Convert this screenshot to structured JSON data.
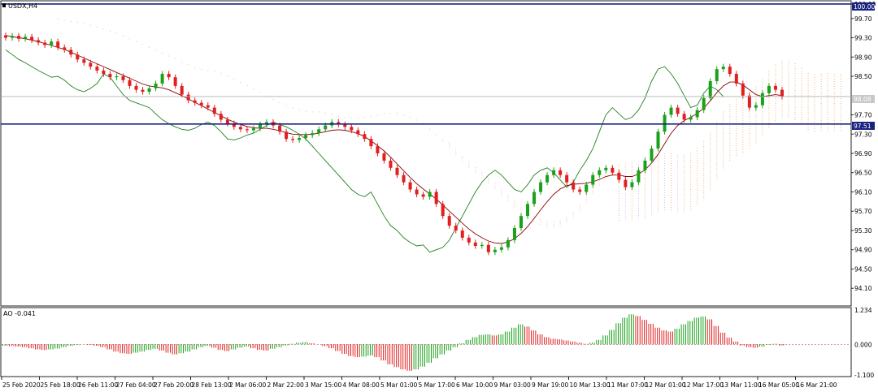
{
  "window": {
    "symbol_label": "USDX,H4"
  },
  "price_levels": {
    "top": "100.00",
    "mid": "98.08",
    "low": "97.51"
  },
  "ao_panel": {
    "label": "AO -0.041"
  },
  "colors": {
    "bull": "#1aa11a",
    "bear": "#e01f1f",
    "ma": "#8b0000",
    "osc": "#208020",
    "cloud_a": "#d8a8d8",
    "cloud_b": "#f0a060",
    "level_line": "#1a237e"
  },
  "chart_data": [
    {
      "type": "candlestick",
      "series": [
        {
          "name": "USDX,H4",
          "closes": [
            99.3,
            99.34,
            99.28,
            99.32,
            99.25,
            99.2,
            99.15,
            99.22,
            99.1,
            99.05,
            98.95,
            98.85,
            98.78,
            98.7,
            98.62,
            98.55,
            98.48,
            98.5,
            98.42,
            98.3,
            98.22,
            98.18,
            98.25,
            98.35,
            98.55,
            98.48,
            98.3,
            98.12,
            98.0,
            97.95,
            97.9,
            97.85,
            97.72,
            97.6,
            97.52,
            97.45,
            97.4,
            97.38,
            97.42,
            97.5,
            97.55,
            97.48,
            97.35,
            97.2,
            97.18,
            97.22,
            97.28,
            97.32,
            97.4,
            97.48,
            97.55,
            97.5,
            97.45,
            97.38,
            97.3,
            97.2,
            97.05,
            96.9,
            96.75,
            96.6,
            96.45,
            96.3,
            96.15,
            96.05,
            96.0,
            96.1,
            95.85,
            95.6,
            95.4,
            95.3,
            95.15,
            95.05,
            94.98,
            95.0,
            94.85,
            94.9,
            94.95,
            95.1,
            95.35,
            95.6,
            95.85,
            96.1,
            96.3,
            96.45,
            96.55,
            96.45,
            96.3,
            96.15,
            96.1,
            96.25,
            96.45,
            96.55,
            96.6,
            96.5,
            96.35,
            96.2,
            96.3,
            96.55,
            96.75,
            97.0,
            97.35,
            97.7,
            97.85,
            97.72,
            97.6,
            97.65,
            97.8,
            98.05,
            98.4,
            98.65,
            98.7,
            98.55,
            98.35,
            98.1,
            97.85,
            97.9,
            98.15,
            98.3,
            98.22,
            98.08
          ]
        },
        {
          "name": "MA",
          "values": [
            99.35,
            99.32,
            99.3,
            99.28,
            99.25,
            99.22,
            99.18,
            99.14,
            99.1,
            99.06,
            99.0,
            98.94,
            98.88,
            98.82,
            98.76,
            98.7,
            98.64,
            98.58,
            98.52,
            98.46,
            98.4,
            98.34,
            98.3,
            98.28,
            98.26,
            98.22,
            98.16,
            98.1,
            98.03,
            97.96,
            97.89,
            97.82,
            97.75,
            97.68,
            97.61,
            97.55,
            97.5,
            97.46,
            97.43,
            97.42,
            97.42,
            97.4,
            97.37,
            97.33,
            97.3,
            97.29,
            97.29,
            97.3,
            97.32,
            97.35,
            97.38,
            97.39,
            97.38,
            97.35,
            97.31,
            97.25,
            97.16,
            97.06,
            96.95,
            96.82,
            96.68,
            96.54,
            96.4,
            96.27,
            96.16,
            96.06,
            95.95,
            95.83,
            95.7,
            95.58,
            95.45,
            95.33,
            95.23,
            95.15,
            95.08,
            95.04,
            95.03,
            95.06,
            95.13,
            95.24,
            95.38,
            95.55,
            95.73,
            95.9,
            96.05,
            96.16,
            96.23,
            96.26,
            96.27,
            96.28,
            96.31,
            96.36,
            96.42,
            96.45,
            96.45,
            96.42,
            96.42,
            96.47,
            96.56,
            96.7,
            96.88,
            97.1,
            97.32,
            97.48,
            97.58,
            97.65,
            97.73,
            97.84,
            97.99,
            98.16,
            98.3,
            98.38,
            98.38,
            98.32,
            98.22,
            98.12,
            98.08,
            98.1,
            98.12,
            98.1
          ]
        },
        {
          "name": "Lagging",
          "values": [
            99.05,
            98.95,
            98.85,
            98.78,
            98.7,
            98.62,
            98.55,
            98.48,
            98.5,
            98.42,
            98.3,
            98.22,
            98.18,
            98.25,
            98.35,
            98.55,
            98.48,
            98.3,
            98.12,
            98.0,
            97.95,
            97.9,
            97.85,
            97.72,
            97.6,
            97.52,
            97.45,
            97.4,
            97.38,
            97.42,
            97.5,
            97.55,
            97.48,
            97.35,
            97.2,
            97.18,
            97.22,
            97.28,
            97.32,
            97.4,
            97.48,
            97.55,
            97.5,
            97.45,
            97.38,
            97.3,
            97.2,
            97.05,
            96.9,
            96.75,
            96.6,
            96.45,
            96.3,
            96.15,
            96.05,
            96.0,
            96.1,
            95.85,
            95.6,
            95.4,
            95.3,
            95.15,
            95.05,
            94.98,
            95.0,
            94.85,
            94.9,
            94.95,
            95.1,
            95.35,
            95.6,
            95.85,
            96.1,
            96.3,
            96.45,
            96.55,
            96.45,
            96.3,
            96.15,
            96.1,
            96.25,
            96.45,
            96.55,
            96.6,
            96.5,
            96.35,
            96.2,
            96.3,
            96.55,
            96.75,
            97.0,
            97.35,
            97.7,
            97.85,
            97.72,
            97.6,
            97.65,
            97.8,
            98.05,
            98.4,
            98.65,
            98.7,
            98.55,
            98.35,
            98.1,
            97.85,
            97.9,
            98.15,
            98.3,
            98.22,
            98.08
          ]
        }
      ],
      "yticks": [
        "100.00",
        "99.70",
        "99.30",
        "98.90",
        "98.50",
        "97.70",
        "97.30",
        "96.90",
        "96.50",
        "96.10",
        "95.70",
        "95.30",
        "94.90",
        "94.50",
        "94.10"
      ],
      "ylim": [
        93.75,
        100.05
      ],
      "xticks": [
        "25 Feb 2020",
        "25 Feb 18:00",
        "26 Feb 11:00",
        "27 Feb 04:00",
        "27 Feb 20:00",
        "28 Feb 13:00",
        "2 Mar 06:00",
        "2 Mar 22:00",
        "3 Mar 15:00",
        "4 Mar 08:00",
        "5 Mar 01:00",
        "5 Mar 17:00",
        "6 Mar 10:00",
        "9 Mar 03:00",
        "9 Mar 19:00",
        "10 Mar 13:00",
        "11 Mar 07:00",
        "12 Mar 01:00",
        "12 Mar 17:00",
        "13 Mar 11:00",
        "16 Mar 05:00",
        "16 Mar 21:00"
      ],
      "horizontal_lines": [
        100.0,
        97.51
      ],
      "grid": false
    },
    {
      "type": "histogram",
      "name": "AO",
      "values": [
        -0.05,
        -0.06,
        -0.08,
        -0.1,
        -0.14,
        -0.18,
        -0.2,
        -0.18,
        -0.15,
        -0.1,
        -0.05,
        -0.02,
        0.0,
        -0.02,
        -0.05,
        -0.1,
        -0.18,
        -0.26,
        -0.32,
        -0.34,
        -0.3,
        -0.26,
        -0.2,
        -0.16,
        -0.22,
        -0.3,
        -0.36,
        -0.32,
        -0.26,
        -0.18,
        -0.1,
        -0.06,
        -0.12,
        -0.2,
        -0.24,
        -0.18,
        -0.12,
        -0.08,
        -0.14,
        -0.2,
        -0.22,
        -0.16,
        -0.1,
        -0.04,
        0.02,
        0.06,
        0.08,
        0.04,
        0.0,
        -0.06,
        -0.14,
        -0.24,
        -0.34,
        -0.42,
        -0.46,
        -0.44,
        -0.4,
        -0.46,
        -0.58,
        -0.72,
        -0.82,
        -0.9,
        -0.95,
        -0.9,
        -0.8,
        -0.66,
        -0.5,
        -0.36,
        -0.22,
        -0.1,
        0.04,
        0.16,
        0.26,
        0.34,
        0.36,
        0.32,
        0.36,
        0.46,
        0.6,
        0.72,
        0.64,
        0.5,
        0.36,
        0.26,
        0.2,
        0.18,
        0.14,
        0.1,
        0.06,
        0.02,
        0.06,
        0.16,
        0.32,
        0.52,
        0.76,
        0.96,
        1.08,
        1.02,
        0.88,
        0.74,
        0.6,
        0.5,
        0.46,
        0.56,
        0.72,
        0.84,
        0.96,
        1.0,
        0.9,
        0.66,
        0.42,
        0.24,
        0.1,
        -0.04,
        -0.1,
        -0.12,
        -0.08,
        -0.02,
        0.02,
        -0.04
      ],
      "yticks": [
        "1.234",
        "0.000",
        "-1.100"
      ],
      "ylim": [
        -1.1,
        1.234
      ],
      "current_value": -0.041
    }
  ]
}
